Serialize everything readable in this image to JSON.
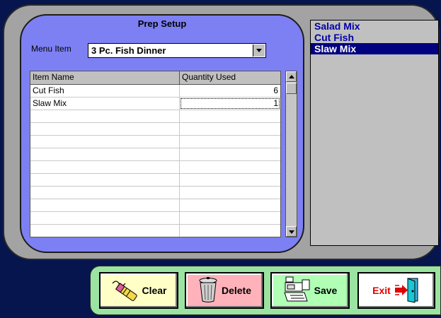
{
  "prep_setup": {
    "title": "Prep Setup",
    "menu_item_label": "Menu Item",
    "menu_item_value": "3 Pc. Fish Dinner",
    "columns": [
      "Item Name",
      "Quantity Used"
    ],
    "rows": [
      {
        "name": "Cut Fish",
        "qty": "6"
      },
      {
        "name": "Slaw Mix",
        "qty": "1"
      }
    ]
  },
  "items_list": {
    "items": [
      "Salad Mix",
      "Cut Fish",
      "Slaw Mix"
    ],
    "selected": "Slaw Mix"
  },
  "toolbar": {
    "clear_label": "Clear",
    "delete_label": "Delete",
    "save_label": "Save",
    "exit_label": "Exit"
  },
  "icons": {
    "clear": "eraser-icon",
    "delete": "trash-can-icon",
    "save": "cash-register-icon",
    "exit": "exit-door-icon",
    "dropdown": "chevron-down-icon",
    "scroll_up": "arrow-up-icon",
    "scroll_down": "arrow-down-icon"
  },
  "colors": {
    "background": "#06154d",
    "prep_panel": "#7d80f2",
    "list_text": "#0000a8",
    "list_selected_bg": "#000080",
    "toolbar_bg": "#9be3a0",
    "clear_btn": "#ffffc6",
    "delete_btn": "#ffb2ba",
    "save_btn": "#b0ffb5",
    "exit_text": "#e00000"
  }
}
